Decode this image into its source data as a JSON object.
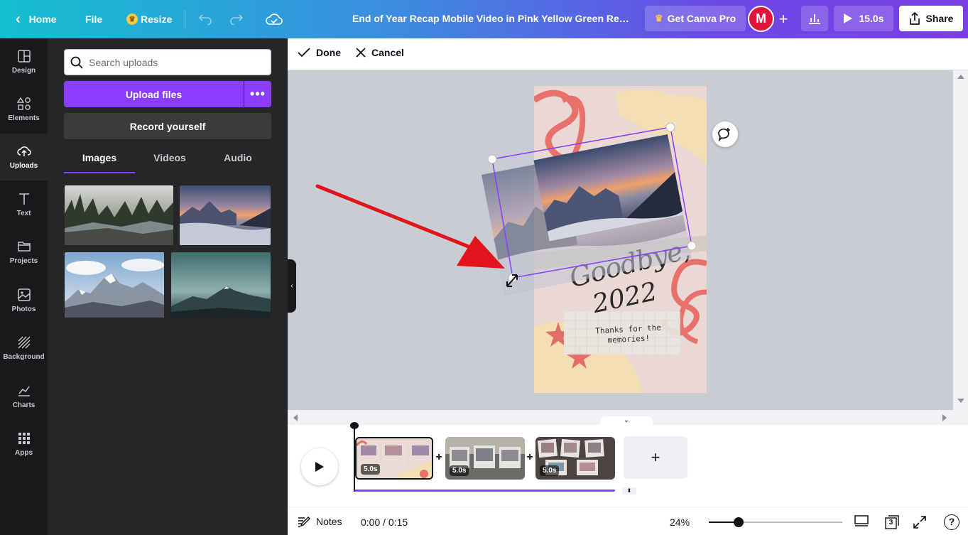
{
  "topbar": {
    "home_label": "Home",
    "file_label": "File",
    "resize_label": "Resize",
    "title": "End of Year Recap Mobile Video in Pink Yellow Green Refine...",
    "pro_label": "Get Canva Pro",
    "avatar_initial": "M",
    "duration_label": "15.0s",
    "share_label": "Share"
  },
  "rail": [
    {
      "label": "Design",
      "icon": "layout-icon"
    },
    {
      "label": "Elements",
      "icon": "shapes-icon"
    },
    {
      "label": "Uploads",
      "icon": "upload-cloud-icon"
    },
    {
      "label": "Text",
      "icon": "text-icon"
    },
    {
      "label": "Projects",
      "icon": "folder-icon"
    },
    {
      "label": "Photos",
      "icon": "image-icon"
    },
    {
      "label": "Background",
      "icon": "hatch-icon"
    },
    {
      "label": "Charts",
      "icon": "chart-icon"
    },
    {
      "label": "Apps",
      "icon": "grid-icon"
    }
  ],
  "panel": {
    "search_placeholder": "Search uploads",
    "upload_label": "Upload files",
    "record_label": "Record yourself",
    "tabs": [
      "Images",
      "Videos",
      "Audio"
    ]
  },
  "editbar": {
    "done_label": "Done",
    "cancel_label": "Cancel"
  },
  "design": {
    "goodbye_text": "Goodbye,",
    "year_text": "2022",
    "note_line1": "Thanks for the",
    "note_line2": "memories!"
  },
  "timeline": {
    "clips": [
      "5.0s",
      "5.0s",
      "5.0s"
    ],
    "page_count": "3"
  },
  "footer": {
    "notes_label": "Notes",
    "time_label": "0:00 / 0:15",
    "zoom_label": "24%"
  },
  "colors": {
    "accent": "#8b3dff",
    "avatar": "#e2133c",
    "arrow": "#e1141c"
  }
}
